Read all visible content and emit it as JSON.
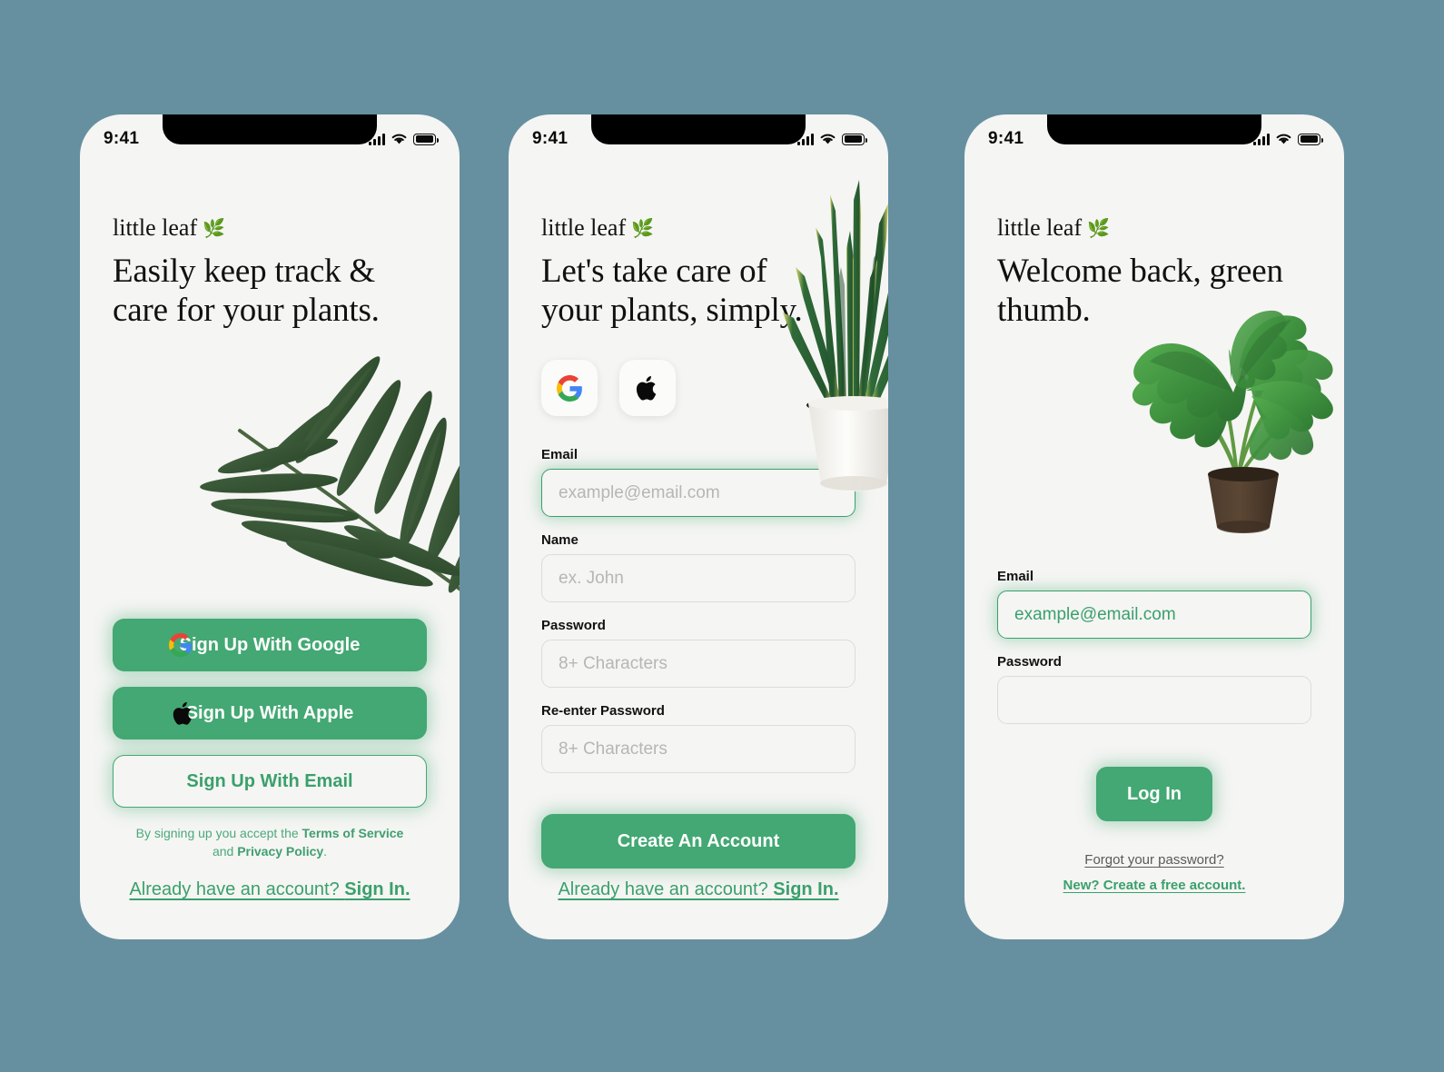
{
  "theme": {
    "background": "#6690a0",
    "screen_bg": "#f5f5f3",
    "accent_green": "#43a873",
    "link_green": "#3aa06c",
    "text_dark": "#111111",
    "placeholder_grey": "#b6b6b4"
  },
  "status_bar": {
    "time": "9:41",
    "signal": "signal-bars",
    "wifi": "wifi",
    "battery": "battery-full"
  },
  "brand": {
    "name": "little leaf",
    "emoji": "🌿"
  },
  "screens": [
    {
      "id": "signup-landing",
      "headline": "Easily keep track & care for your plants.",
      "art": "palm-frond",
      "buttons": [
        {
          "label": "Sign Up With Google",
          "icon": "google-icon",
          "style": "filled"
        },
        {
          "label": "Sign Up With Apple",
          "icon": "apple-icon",
          "style": "filled"
        },
        {
          "label": "Sign Up With Email",
          "icon": "none",
          "style": "outline"
        }
      ],
      "terms": {
        "lead": "By signing up you accept the ",
        "terms_link": "Terms of Service",
        "conjunction": " and ",
        "privacy_link": "Privacy Policy",
        "trailing": "."
      },
      "footer": {
        "text": "Already have an account? ",
        "link": "Sign In."
      }
    },
    {
      "id": "create-account",
      "headline": "Let's take care of your plants, simply.",
      "art": "snake-plant",
      "social": [
        {
          "name": "google-icon",
          "label": "Sign up with Google"
        },
        {
          "name": "apple-icon",
          "label": "Sign up with Apple"
        }
      ],
      "fields": [
        {
          "label": "Email",
          "placeholder": "example@email.com",
          "value": "",
          "focused": true
        },
        {
          "label": "Name",
          "placeholder": "ex. John",
          "value": "",
          "focused": false
        },
        {
          "label": "Password",
          "placeholder": "8+ Characters",
          "value": "",
          "focused": false
        },
        {
          "label": "Re-enter Password",
          "placeholder": "8+ Characters",
          "value": "",
          "focused": false
        }
      ],
      "submit": "Create An Account",
      "footer": {
        "text": "Already have an account? ",
        "link": "Sign In."
      }
    },
    {
      "id": "login",
      "headline": "Welcome back, green thumb.",
      "art": "monstera",
      "fields": [
        {
          "label": "Email",
          "placeholder": "example@email.com",
          "value": "example@email.com",
          "focused": true
        },
        {
          "label": "Password",
          "placeholder": "",
          "value": "",
          "focused": false
        }
      ],
      "submit": "Log In",
      "links": [
        {
          "text": "Forgot your password?",
          "style": "grey"
        },
        {
          "text": "New? Create a free account.",
          "style": "green"
        }
      ]
    }
  ]
}
